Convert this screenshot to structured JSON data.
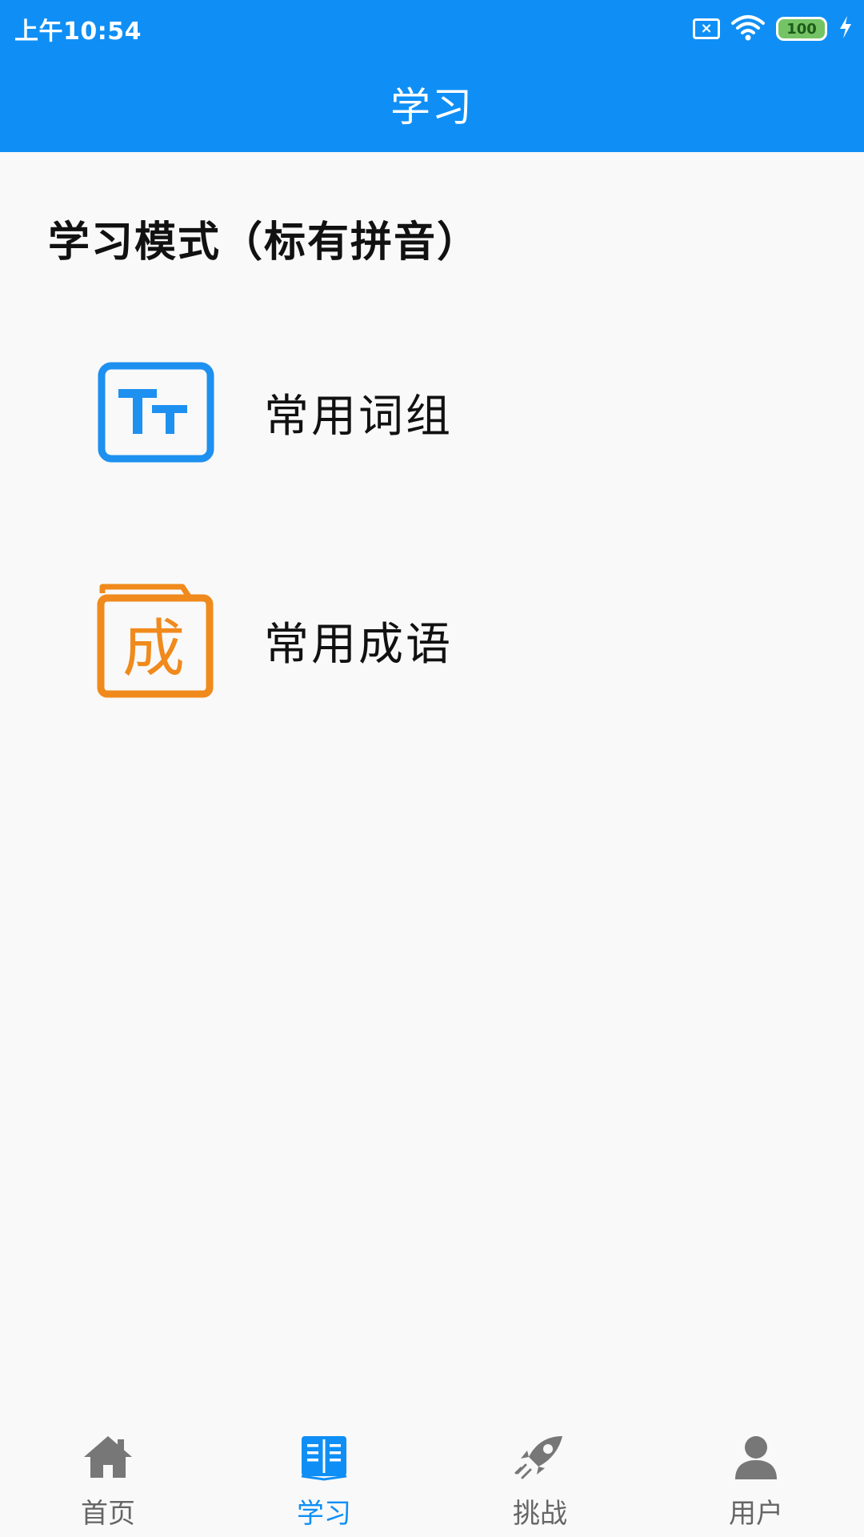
{
  "status_bar": {
    "time": "上午10:54",
    "sim_glyph": "×",
    "battery": "100"
  },
  "header": {
    "title": "学习"
  },
  "section": {
    "title": "学习模式（标有拼音）"
  },
  "entries": [
    {
      "label": "常用词组",
      "icon": "tt-icon",
      "icon_color": "#1e90f0"
    },
    {
      "label": "常用成语",
      "icon": "cheng-icon",
      "icon_color": "#f08a1c",
      "icon_text": "成"
    }
  ],
  "bottom_nav": {
    "active_index": 1,
    "active_color": "#0f8ff5",
    "items": [
      {
        "label": "首页",
        "icon": "home-icon"
      },
      {
        "label": "学习",
        "icon": "book-icon"
      },
      {
        "label": "挑战",
        "icon": "rocket-icon"
      },
      {
        "label": "用户",
        "icon": "user-icon"
      }
    ]
  },
  "colors": {
    "header_bg": "#0f8ff5",
    "page_bg": "#f9f9f9"
  }
}
